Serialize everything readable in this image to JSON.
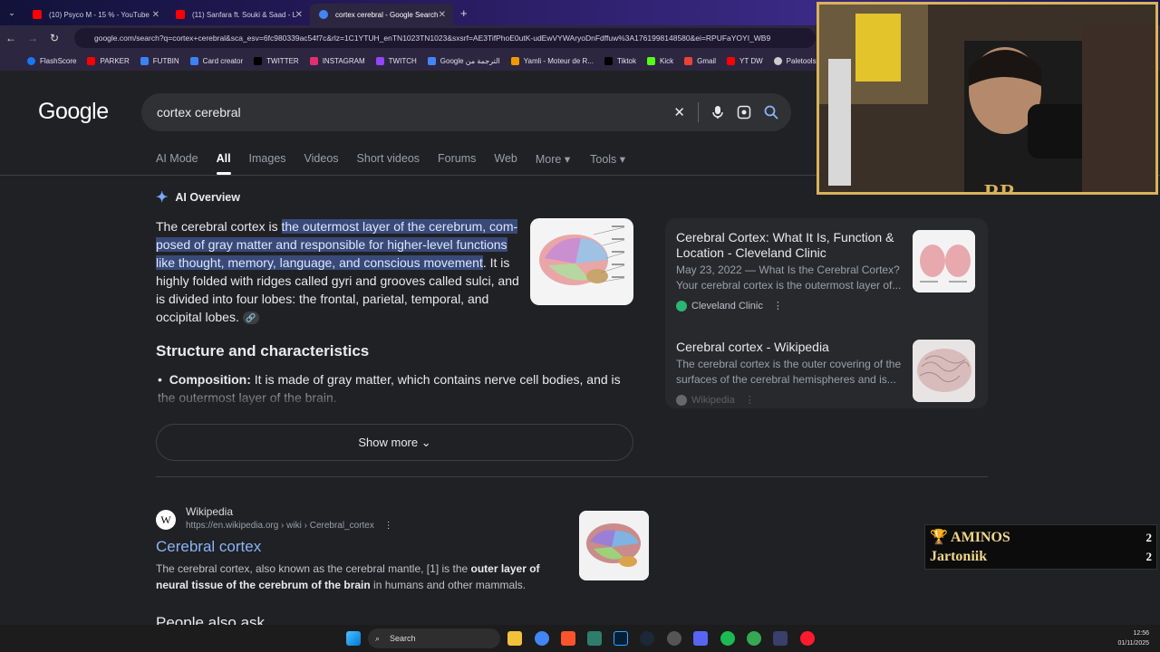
{
  "browser": {
    "tabs": [
      {
        "label": "(10) Psyco M - 15 % - YouTube",
        "color": "#ff0000"
      },
      {
        "label": "(11) Sanfara ft. Souki & Saad - L",
        "color": "#ff0000"
      },
      {
        "label": "cortex cerebral - Google Search",
        "color": "#4285f4"
      }
    ],
    "new_tab": "+",
    "url": "google.com/search?q=cortex+cerebral&sca_esv=6fc980339ac54f7c&rlz=1C1YTUH_enTN1023TN1023&sxsrf=AE3TifPhoE0utK-udEwVYWAryoDnFdffuw%3A1761998148580&ei=RPUFaYOYI_WB9",
    "bookmarks": [
      "FlashScore",
      "PARKER",
      "FUTBIN",
      "Card creator",
      "TWITTER",
      "INSTAGRAM",
      "TWITCH",
      "Google الترجمة من",
      "Yamli - Moteur de R...",
      "Tiktok",
      "Kick",
      "Gmail",
      "YT DW",
      "Paletools"
    ]
  },
  "google": {
    "logo": "Google",
    "query": "cortex cerebral",
    "tabs": [
      "AI Mode",
      "All",
      "Images",
      "Videos",
      "Short videos",
      "Forums",
      "Web",
      "More ▾",
      "Tools ▾"
    ],
    "ai_overview_label": "AI Overview",
    "ai_text_start": "The cerebral cortex is ",
    "ai_text_highlight": "the outermost layer of the cerebrum, com-posed of gray matter and responsible for higher-level functions like thought, memory, language, and conscious movement",
    "ai_text_end": ". It is highly folded with ridges called gyri and grooves called sulci, and is divided into four lobes: the frontal, parietal, temporal, and occipital lobes.",
    "structure_heading": "Structure and characteristics",
    "bullet_bold": "Composition:",
    "bullet_text": " It is made of gray matter, which contains nerve cell bodies, and is the outermost layer of the brain.",
    "show_more": "Show more",
    "side_results": [
      {
        "title": "Cerebral Cortex: What It Is, Function & Location - Cleveland Clinic",
        "snippet": "May 23, 2022 — What Is the Cerebral Cortex? Your cerebral cortex is the outermost layer of...",
        "source": "Cleveland Clinic"
      },
      {
        "title": "Cerebral cortex - Wikipedia",
        "snippet": "The cerebral cortex is the outer covering of the surfaces of the cerebral hemispheres and is...",
        "source": "Wikipedia"
      }
    ],
    "result": {
      "site": "Wikipedia",
      "url": "https://en.wikipedia.org › wiki › Cerebral_cortex",
      "title": "Cerebral cortex",
      "snippet_a": "The cerebral cortex, also known as the cerebral mantle, [1] is the ",
      "snippet_bold": "outer layer of neural tissue of the cerebrum of the brain",
      "snippet_b": " in humans and other mammals."
    },
    "people_also_ask": "People also ask"
  },
  "taskbar": {
    "search": "Search",
    "time": "12:56",
    "date": "01/11/2025"
  },
  "overlay": {
    "rows": [
      {
        "name": "🏆 AMINOS",
        "score": "2"
      },
      {
        "name": "Jartoniik",
        "score": "2"
      }
    ]
  },
  "webcam_brand": "RR"
}
